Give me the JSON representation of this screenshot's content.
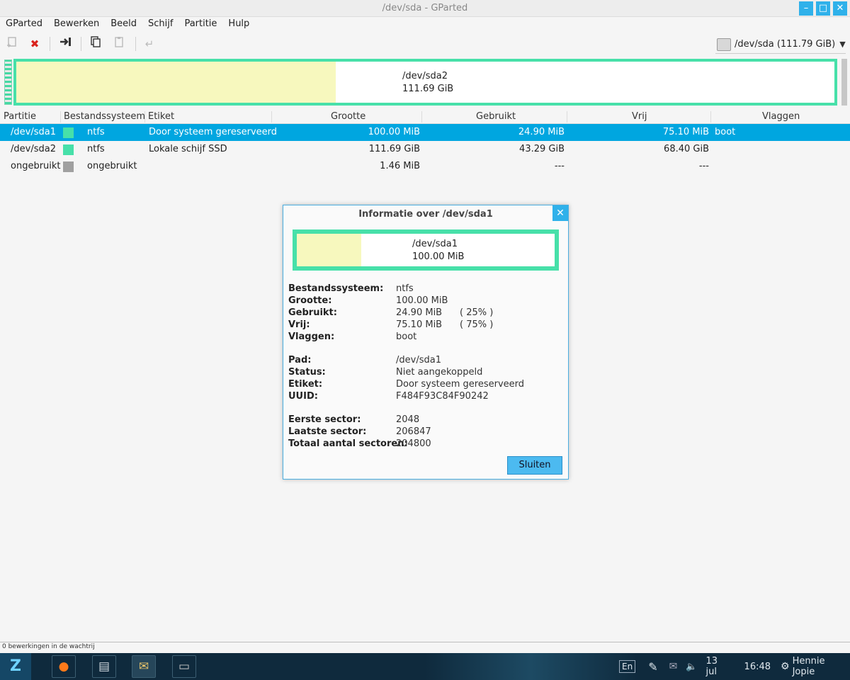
{
  "window": {
    "title": "/dev/sda - GParted",
    "min_icon": "minimize-icon",
    "max_icon": "maximize-icon",
    "close_icon": "close-icon"
  },
  "menu": [
    "GParted",
    "Bewerken",
    "Beeld",
    "Schijf",
    "Partitie",
    "Hulp"
  ],
  "toolbar": {
    "icons": [
      "new-partition-icon",
      "delete-icon",
      "resize-move-icon",
      "copy-icon",
      "paste-icon",
      "undo-icon"
    ],
    "device": "/dev/sda  (111.79 GiB)"
  },
  "diskmap": {
    "name": "/dev/sda2",
    "size": "111.69 GiB",
    "used_fraction": 0.388
  },
  "table": {
    "headers": [
      "Partitie",
      "Bestandssysteem",
      "Etiket",
      "Grootte",
      "Gebruikt",
      "Vrij",
      "Vlaggen"
    ],
    "rows": [
      {
        "partition": "/dev/sda1",
        "fs": "ntfs",
        "color": "#47e0a9",
        "label": "Door systeem gereserveerd",
        "size": "100.00 MiB",
        "used": "24.90 MiB",
        "free": "75.10 MiB",
        "flags": "boot",
        "selected": true
      },
      {
        "partition": "/dev/sda2",
        "fs": "ntfs",
        "color": "#47e0a9",
        "label": "Lokale schijf SSD",
        "size": "111.69 GiB",
        "used": "43.29 GiB",
        "free": "68.40 GiB",
        "flags": "",
        "selected": false
      },
      {
        "partition": "ongebruikt",
        "fs": "ongebruikt",
        "color": "#a0a0a0",
        "label": "",
        "size": "1.46 MiB",
        "used": "---",
        "free": "---",
        "flags": "",
        "selected": false
      }
    ]
  },
  "dialog": {
    "title": "Informatie over /dev/sda1",
    "map": {
      "name": "/dev/sda1",
      "size": "100.00 MiB",
      "used_fraction": 0.25
    },
    "fields": {
      "fs_k": "Bestandssysteem:",
      "fs_v": "ntfs",
      "size_k": "Grootte:",
      "size_v": "100.00 MiB",
      "used_k": "Gebruikt:",
      "used_v": "24.90 MiB",
      "used_p": "( 25% )",
      "free_k": "Vrij:",
      "free_v": "75.10 MiB",
      "free_p": "( 75% )",
      "flags_k": "Vlaggen:",
      "flags_v": "boot",
      "path_k": "Pad:",
      "path_v": "/dev/sda1",
      "status_k": "Status:",
      "status_v": "Niet aangekoppeld",
      "label_k": "Etiket:",
      "label_v": "Door systeem gereserveerd",
      "uuid_k": "UUID:",
      "uuid_v": "F484F93C84F90242",
      "first_k": "Eerste sector:",
      "first_v": "2048",
      "last_k": "Laatste sector:",
      "last_v": "206847",
      "total_k": "Totaal aantal sectoren:",
      "total_v": "204800"
    },
    "close_button": "Sluiten"
  },
  "statusbar": "0 bewerkingen in de wachtrij",
  "taskbar": {
    "apps": [
      "firefox-icon",
      "file-manager-icon",
      "mail-icon",
      "disk-utility-icon"
    ],
    "lang": "En",
    "date": "13 jul",
    "time": "16:48",
    "user": "Hennie Jopie"
  }
}
